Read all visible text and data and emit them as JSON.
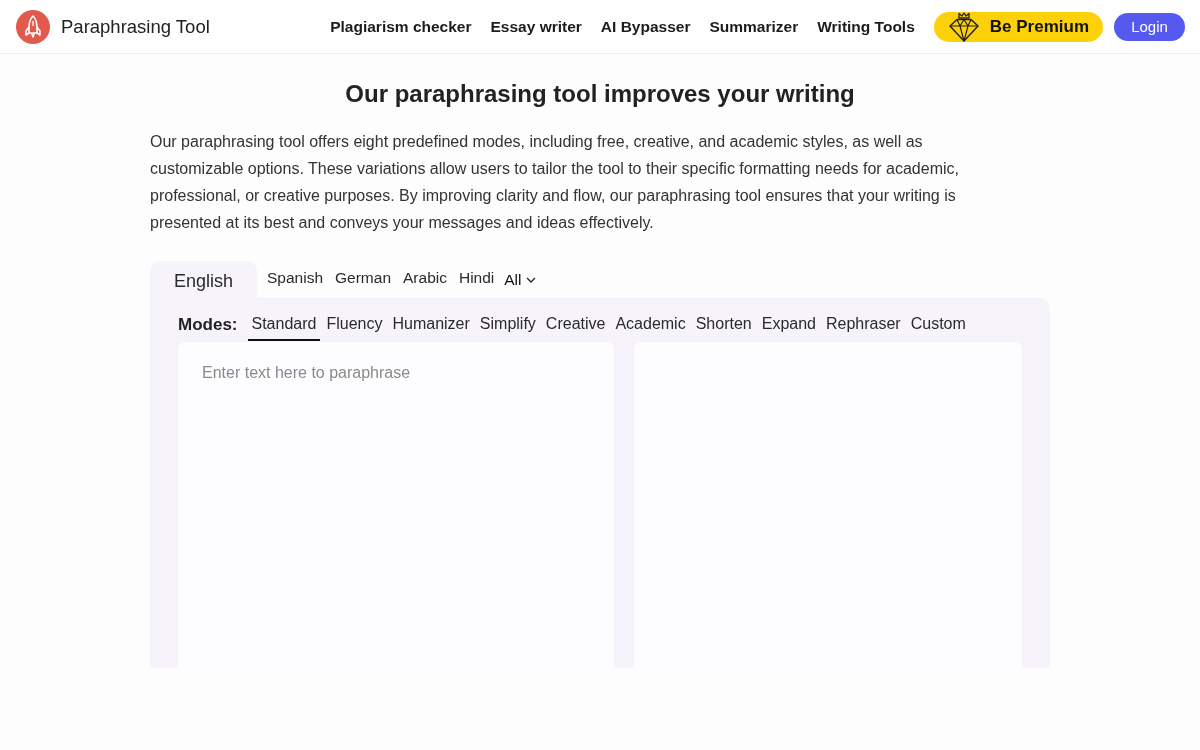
{
  "header": {
    "logo_text": "Paraphrasing Tool",
    "nav": [
      "Plagiarism checker",
      "Essay writer",
      "AI Bypasser",
      "Summarizer",
      "Writing Tools"
    ],
    "premium_button": "Be Premium",
    "login_button": "Login"
  },
  "heading": "Our paraphrasing tool improves your writing",
  "description": "Our paraphrasing tool offers eight predefined modes, including free, creative, and academic styles, as well as customizable options. These variations allow users to tailor the tool to their specific formatting needs for academic, professional, or creative purposes. By improving clarity and flow, our paraphrasing tool ensures that your writing is presented at its best and conveys your messages and ideas effectively.",
  "language_tabs": [
    {
      "label": "English",
      "selected": true
    },
    {
      "label": "Spanish",
      "selected": false
    },
    {
      "label": "German",
      "selected": false
    },
    {
      "label": "Arabic",
      "selected": false
    },
    {
      "label": "Hindi",
      "selected": false
    }
  ],
  "language_menu": {
    "label": "All"
  },
  "modes": {
    "label": "Modes:",
    "items": [
      {
        "label": "Standard",
        "selected": true
      },
      {
        "label": "Fluency",
        "selected": false
      },
      {
        "label": "Humanizer",
        "selected": false
      },
      {
        "label": "Simplify",
        "selected": false
      },
      {
        "label": "Creative",
        "selected": false
      },
      {
        "label": "Academic",
        "selected": false
      },
      {
        "label": "Shorten",
        "selected": false
      },
      {
        "label": "Expand",
        "selected": false
      },
      {
        "label": "Rephraser",
        "selected": false
      },
      {
        "label": "Custom",
        "selected": false
      }
    ]
  },
  "input_pane": {
    "placeholder": "Enter text here to paraphrase"
  }
}
